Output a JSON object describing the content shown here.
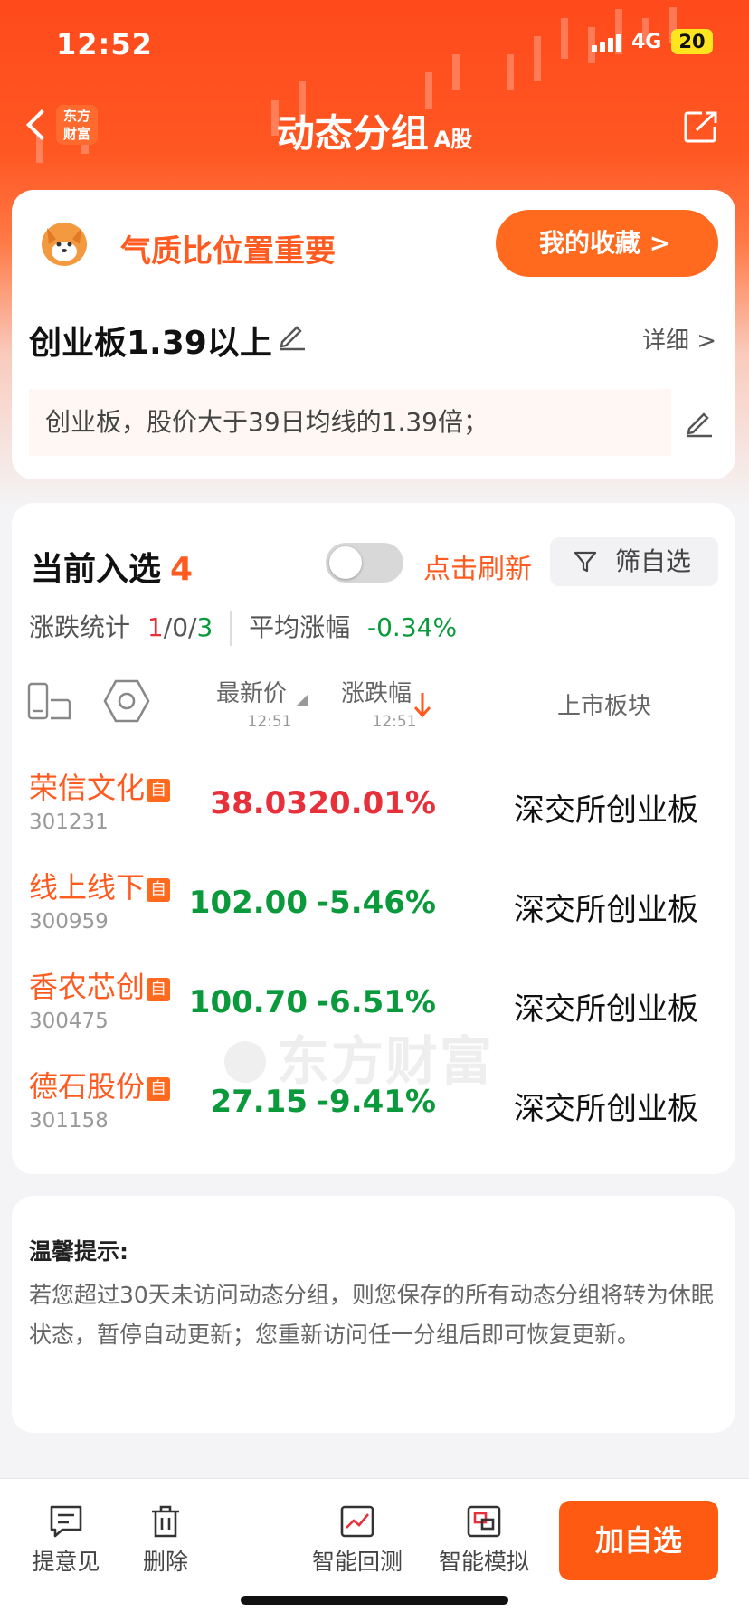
{
  "status": {
    "time": "12:52",
    "network": "4G",
    "battery": "20"
  },
  "header": {
    "logo": "东方\n财富",
    "title": "动态分组",
    "title_suffix": "A股"
  },
  "banner": {
    "motto": "气质比位置重要",
    "favorites": "我的收藏 >"
  },
  "group": {
    "name": "创业板1.39以上",
    "detail": "详细 >",
    "description": "创业板，股价大于39日均线的1.39倍；"
  },
  "selection": {
    "label": "当前入选",
    "count": "4",
    "refresh": "点击刷新",
    "filter": "筛自选",
    "stats_label": "涨跌统计",
    "stats_up": "1",
    "stats_flat": "0",
    "stats_down": "3",
    "stats_slash": "/",
    "avg_label": "平均涨幅",
    "avg_value": "-0.34%"
  },
  "columns": {
    "price": "最新价",
    "price_time": "12:51",
    "change": "涨跌幅",
    "change_time": "12:51",
    "sector": "上市板块"
  },
  "stocks": [
    {
      "name": "荣信文化",
      "tag": "自",
      "code": "301231",
      "price": "38.03",
      "change": "20.01%",
      "sector": "深交所创业板",
      "trend": "up"
    },
    {
      "name": "线上线下",
      "tag": "自",
      "code": "300959",
      "price": "102.00",
      "change": "-5.46%",
      "sector": "深交所创业板",
      "trend": "down"
    },
    {
      "name": "香农芯创",
      "tag": "自",
      "code": "300475",
      "price": "100.70",
      "change": "-6.51%",
      "sector": "深交所创业板",
      "trend": "down"
    },
    {
      "name": "德石股份",
      "tag": "自",
      "code": "301158",
      "price": "27.15",
      "change": "-9.41%",
      "sector": "深交所创业板",
      "trend": "down"
    }
  ],
  "watermark": "东方财富",
  "tip": {
    "title": "温馨提示:",
    "body": "若您超过30天未访问动态分组，则您保存的所有动态分组将转为休眠状态，暂停自动更新；您重新访问任一分组后即可恢复更新。"
  },
  "bottom": {
    "feedback": "提意见",
    "delete": "删除",
    "backtest": "智能回测",
    "simulate": "智能模拟",
    "add": "加自选"
  },
  "colors": {
    "accent": "#ff5a1f",
    "up": "#e8303b",
    "down": "#0a9a3c"
  }
}
